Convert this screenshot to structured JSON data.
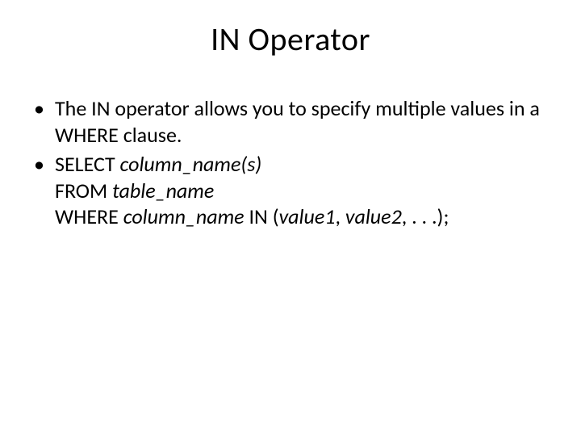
{
  "title": "IN Operator",
  "bullet1": "The IN operator allows you to specify multiple values in a WHERE clause.",
  "bullet2": {
    "select": "SELECT ",
    "cols": "column_name(s)",
    "from": "FROM ",
    "table": "table_name",
    "where": "WHERE ",
    "col": "column_name",
    "in": " IN (",
    "v1": "value1",
    "c1": ", ",
    "v2": "value2",
    "end": ", . . .);"
  }
}
